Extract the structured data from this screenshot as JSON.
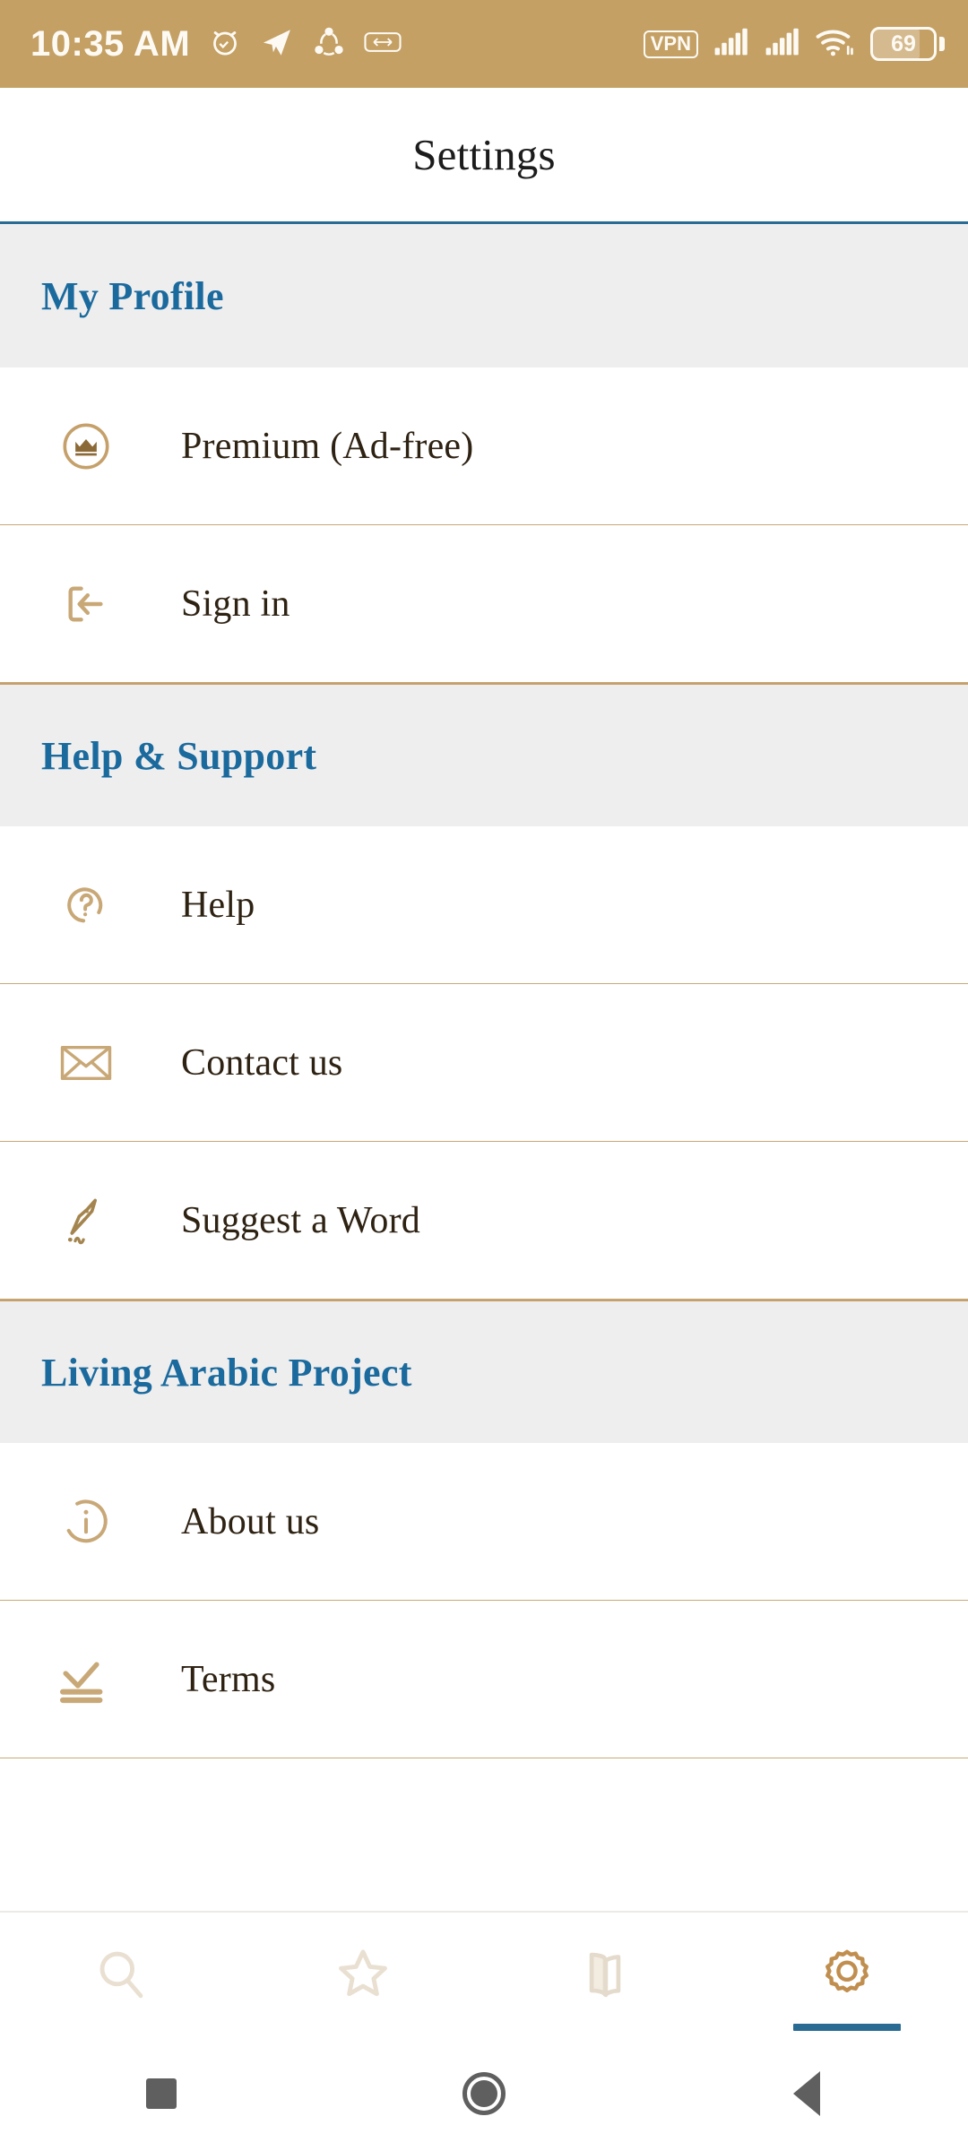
{
  "status_bar": {
    "time": "10:35 AM",
    "left_icons": [
      "alarm-icon",
      "telegram-icon",
      "shareit-icon",
      "card-icon"
    ],
    "vpn_label": "VPN",
    "right_icons": [
      "vpn-badge",
      "signal-icon-1",
      "signal-icon-2",
      "wifi-icon"
    ],
    "battery_percent": "69",
    "background_color": "#c4a064",
    "foreground_color": "#fdfaf4"
  },
  "app_bar": {
    "title": "Settings",
    "underline_color": "#2a6b94"
  },
  "theme": {
    "accent_blue": "#1b6a9e",
    "accent_gold": "#c5a06a",
    "section_bg": "#eeeeee",
    "text_dark": "#2e2213"
  },
  "sections": [
    {
      "title": "My Profile",
      "rows": [
        {
          "label": "Premium (Ad-free)",
          "icon": "crown-circle-icon"
        },
        {
          "label": "Sign in",
          "icon": "sign-in-icon"
        }
      ]
    },
    {
      "title": "Help & Support",
      "rows": [
        {
          "label": "Help",
          "icon": "question-circle-icon"
        },
        {
          "label": "Contact us",
          "icon": "envelope-icon"
        },
        {
          "label": "Suggest a Word",
          "icon": "pen-nib-icon"
        }
      ]
    },
    {
      "title": "Living Arabic Project",
      "rows": [
        {
          "label": "About us",
          "icon": "info-circle-icon"
        },
        {
          "label": "Terms",
          "icon": "terms-check-icon"
        }
      ]
    }
  ],
  "tab_bar": {
    "tabs": [
      {
        "name": "search",
        "icon": "magnifier-icon",
        "active": false
      },
      {
        "name": "favorites",
        "icon": "star-icon",
        "active": false
      },
      {
        "name": "flashcards",
        "icon": "book-icon",
        "active": false
      },
      {
        "name": "settings",
        "icon": "gear-icon",
        "active": true
      }
    ],
    "active_indicator_color": "#2a6b94"
  },
  "android_nav": {
    "buttons": [
      "recents-square-icon",
      "home-circle-icon",
      "back-triangle-icon"
    ]
  }
}
